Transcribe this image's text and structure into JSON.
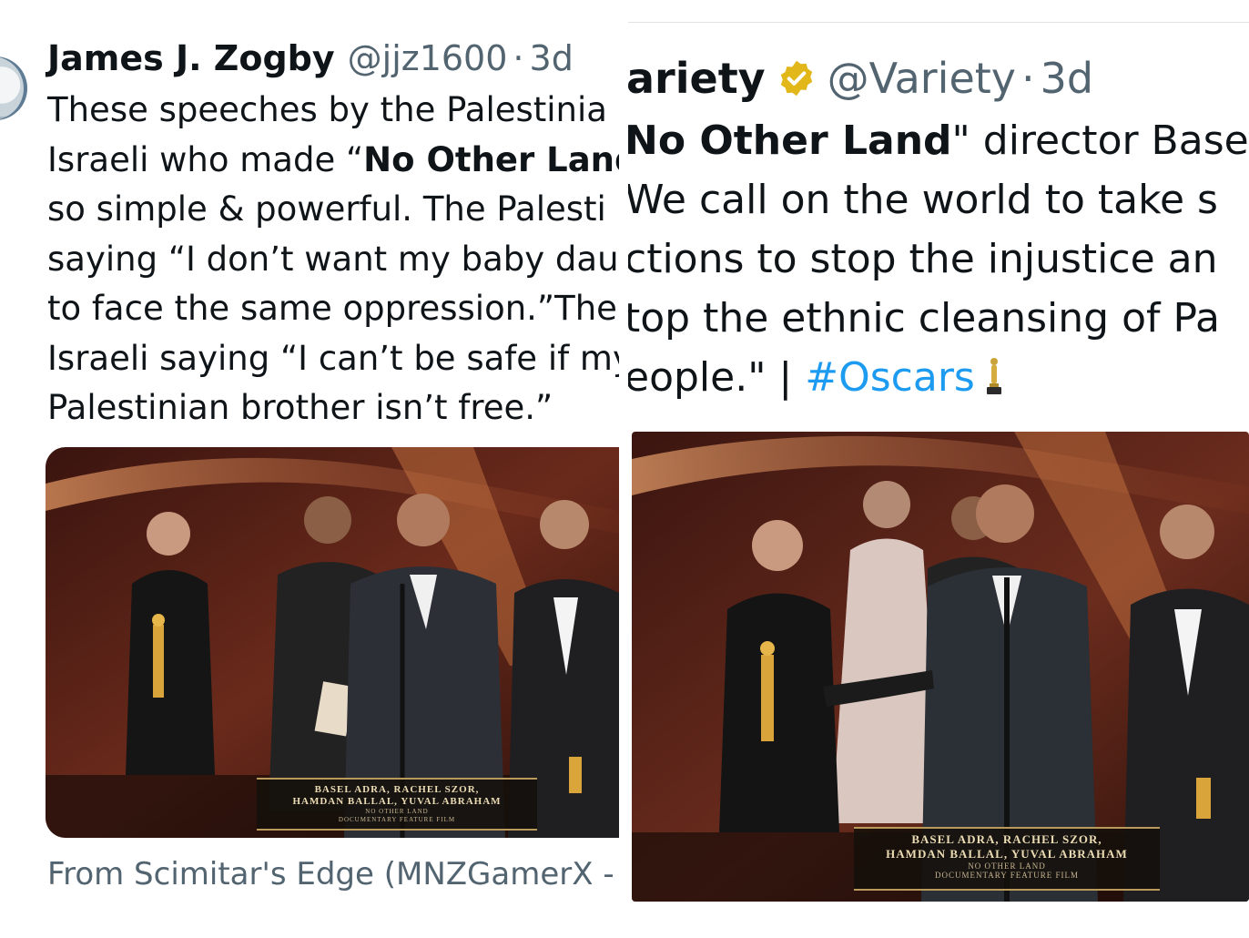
{
  "left_tweet": {
    "display_name": "James J. Zogby",
    "handle": "@jjz1600",
    "separator": "·",
    "age": "3d",
    "text_lines": [
      [
        "These speeches by the Palestinia"
      ],
      [
        "Israeli who made “",
        "No Other Land"
      ],
      [
        "so simple & powerful. The Palesti"
      ],
      [
        "saying “I don’t want my baby daug"
      ],
      [
        "to face the same oppression.”The"
      ],
      [
        "Israeli saying “I can’t be safe if my"
      ],
      [
        "Palestinian brother isn’t free.”"
      ]
    ],
    "media_overlay": {
      "line1": "BASEL ADRA, RACHEL SZOR,",
      "line2": "HAMDAN BALLAL, YUVAL ABRAHAM",
      "line3": "NO OTHER LAND",
      "line4": "DOCUMENTARY FEATURE FILM"
    },
    "source_label": "From Scimitar's Edge (MNZGamerX - A"
  },
  "right_tweet": {
    "display_name": "ariety",
    "verified_badge": "gold-check-badge-icon",
    "handle": "@Variety",
    "separator": "·",
    "age": "3d",
    "text_lines": {
      "l1_bold": "No Other Land",
      "l1_rest": "\" director Base",
      "l1_quote": "\"",
      "l2": "We call on the world to take s",
      "l3": "ctions to stop the injustice an",
      "l4": "top the ethnic cleansing of Pa",
      "l5_pre": "eople.\" | ",
      "l5_hashtag": "#Oscars",
      "l5_emoji": "trophy-icon"
    },
    "media_overlay": {
      "line1": "BASEL ADRA, RACHEL SZOR,",
      "line2": "HAMDAN BALLAL, YUVAL ABRAHAM",
      "line3": "NO OTHER LAND",
      "line4": "DOCUMENTARY FEATURE FILM"
    }
  },
  "colors": {
    "text": "#0f1419",
    "secondary": "#536471",
    "link": "#1d9bf0",
    "verified_gold": "#e2b719"
  }
}
